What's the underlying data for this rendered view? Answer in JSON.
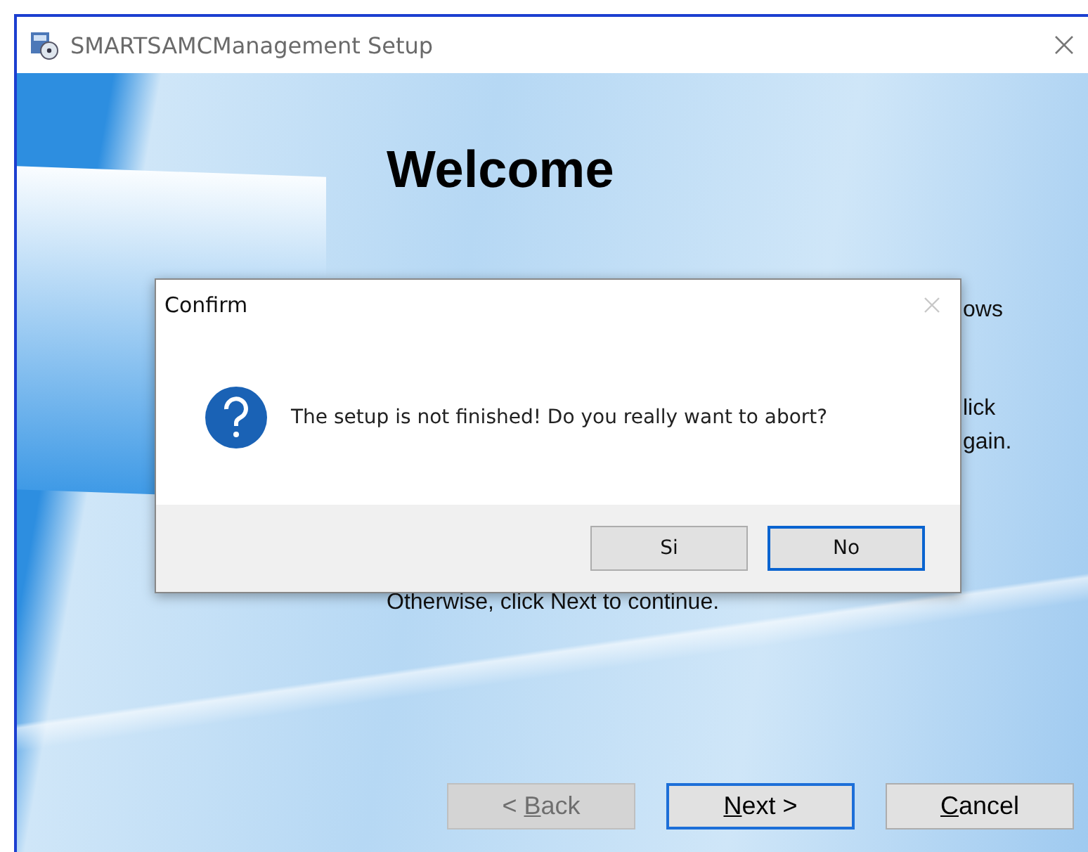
{
  "window": {
    "title": "SMARTSAMCManagement  Setup"
  },
  "wizard": {
    "heading": "Welcome",
    "visible_fragments": [
      {
        "text": "ows"
      },
      {
        "text": "lick"
      },
      {
        "text": "gain."
      }
    ],
    "last_line": "Otherwise, click Next to continue."
  },
  "wizard_buttons": [
    {
      "before": "< ",
      "key": "B",
      "after": "ack",
      "disabled": true,
      "default": false
    },
    {
      "key": "N",
      "after": "ext >",
      "disabled": false,
      "default": true
    },
    {
      "key": "C",
      "after": "ancel",
      "disabled": false,
      "default": false
    }
  ],
  "dialog": {
    "title": "Confirm",
    "message": "The setup is not finished! Do you really want to abort?",
    "buttons": [
      {
        "label": "Si",
        "default": false
      },
      {
        "label": "No",
        "default": true
      }
    ]
  }
}
